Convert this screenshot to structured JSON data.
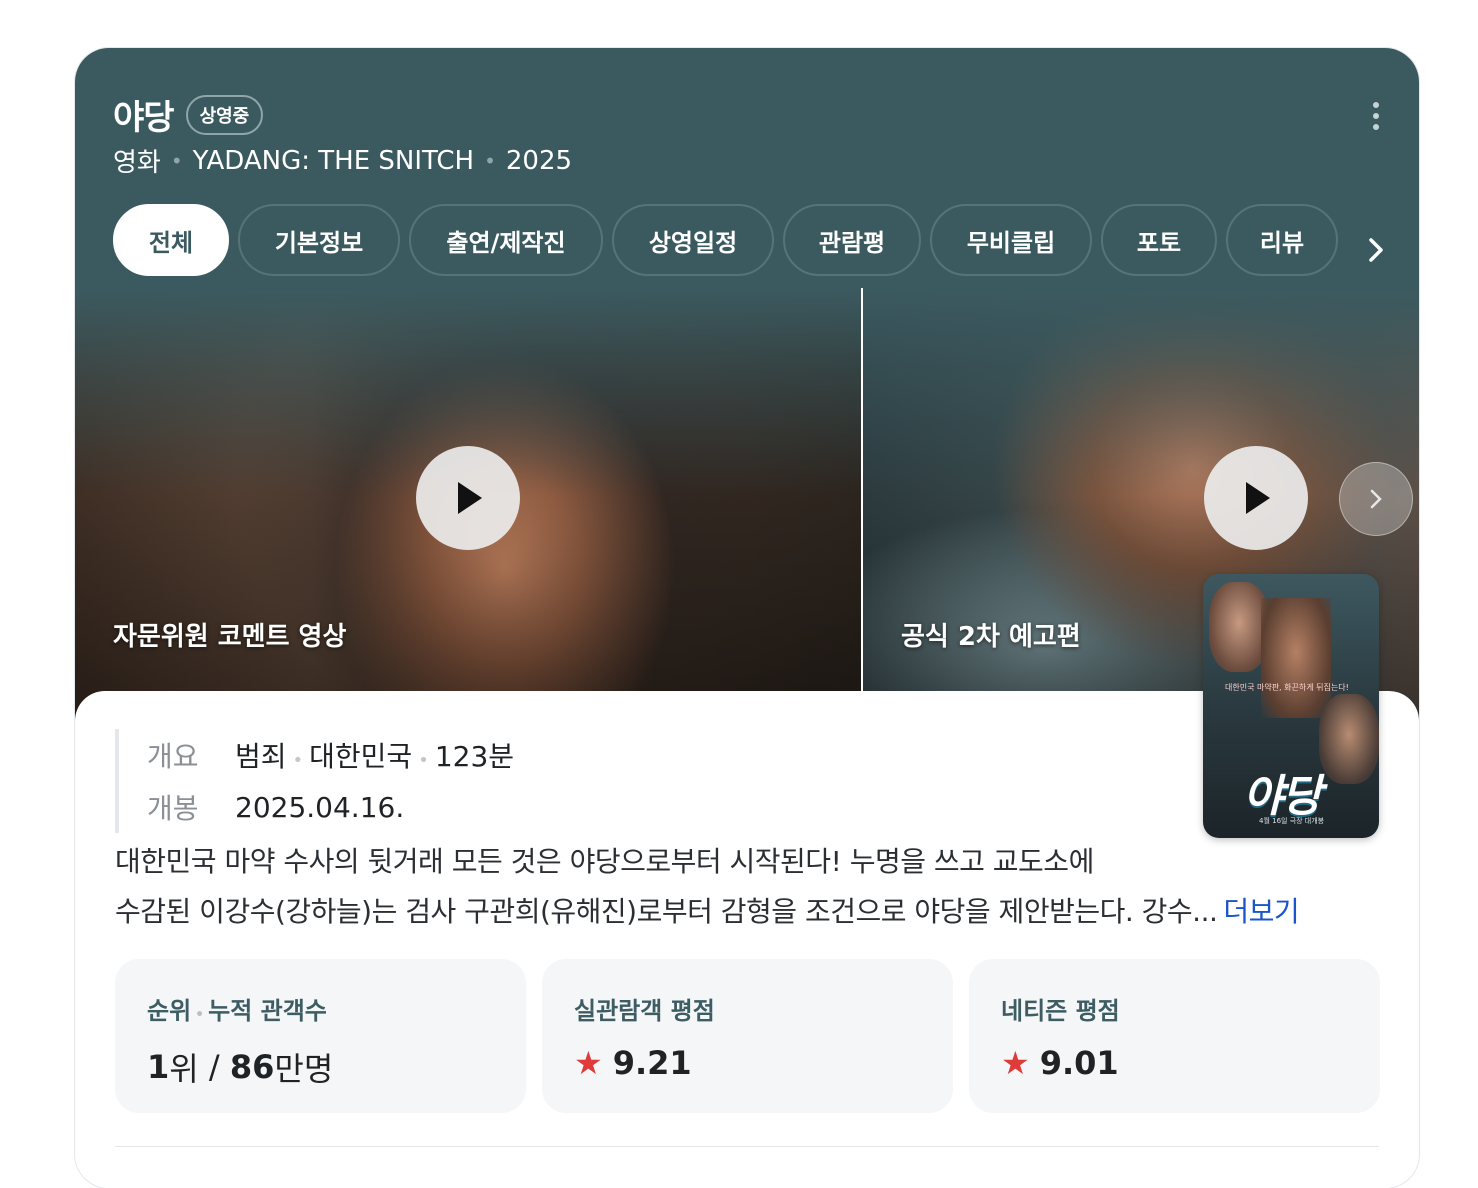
{
  "header": {
    "title": "야당",
    "status_badge": "상영중",
    "subtitle": {
      "category": "영화",
      "english_title": "YADANG: THE SNITCH",
      "year": "2025"
    },
    "more_icon": "more-vert-icon"
  },
  "tabs": [
    {
      "label": "전체",
      "active": true
    },
    {
      "label": "기본정보",
      "active": false
    },
    {
      "label": "출연/제작진",
      "active": false
    },
    {
      "label": "상영일정",
      "active": false
    },
    {
      "label": "관람평",
      "active": false
    },
    {
      "label": "무비클립",
      "active": false
    },
    {
      "label": "포토",
      "active": false
    },
    {
      "label": "리뷰",
      "active": false
    }
  ],
  "clips": [
    {
      "title": "자문위원 코멘트 영상"
    },
    {
      "title": "공식 2차 예고편"
    }
  ],
  "facts": {
    "overview_label": "개요",
    "genre": "범죄",
    "country": "대한민국",
    "runtime": "123분",
    "release_label": "개봉",
    "release_date": "2025.04.16."
  },
  "poster": {
    "title": "야당",
    "tagline": "대한민국 마약판, 화끈하게 뒤집는다!",
    "date": "4월 16일 극장 대개봉"
  },
  "synopsis": {
    "line1": "대한민국 마약 수사의 뒷거래 모든 것은 야당으로부터 시작된다! 누명을 쓰고 교도소에",
    "line2": "수감된 이강수(강하늘)는 검사 구관희(유해진)로부터 감형을 조건으로 야당을 제안받는다. 강수...",
    "more_label": "더보기"
  },
  "stats": {
    "rank": {
      "label_a": "순위",
      "label_b": "누적 관객수",
      "rank_num": "1",
      "rank_unit": "위",
      "slash": " / ",
      "audience_num": "86",
      "audience_unit": "만명"
    },
    "audience_rating": {
      "label": "실관람객 평점",
      "value": "9.21"
    },
    "netizen_rating": {
      "label": "네티즌 평점",
      "value": "9.01"
    }
  },
  "colors": {
    "header_bg": "#3b5a60",
    "star": "#e03b3b",
    "link": "#1a56c9"
  }
}
